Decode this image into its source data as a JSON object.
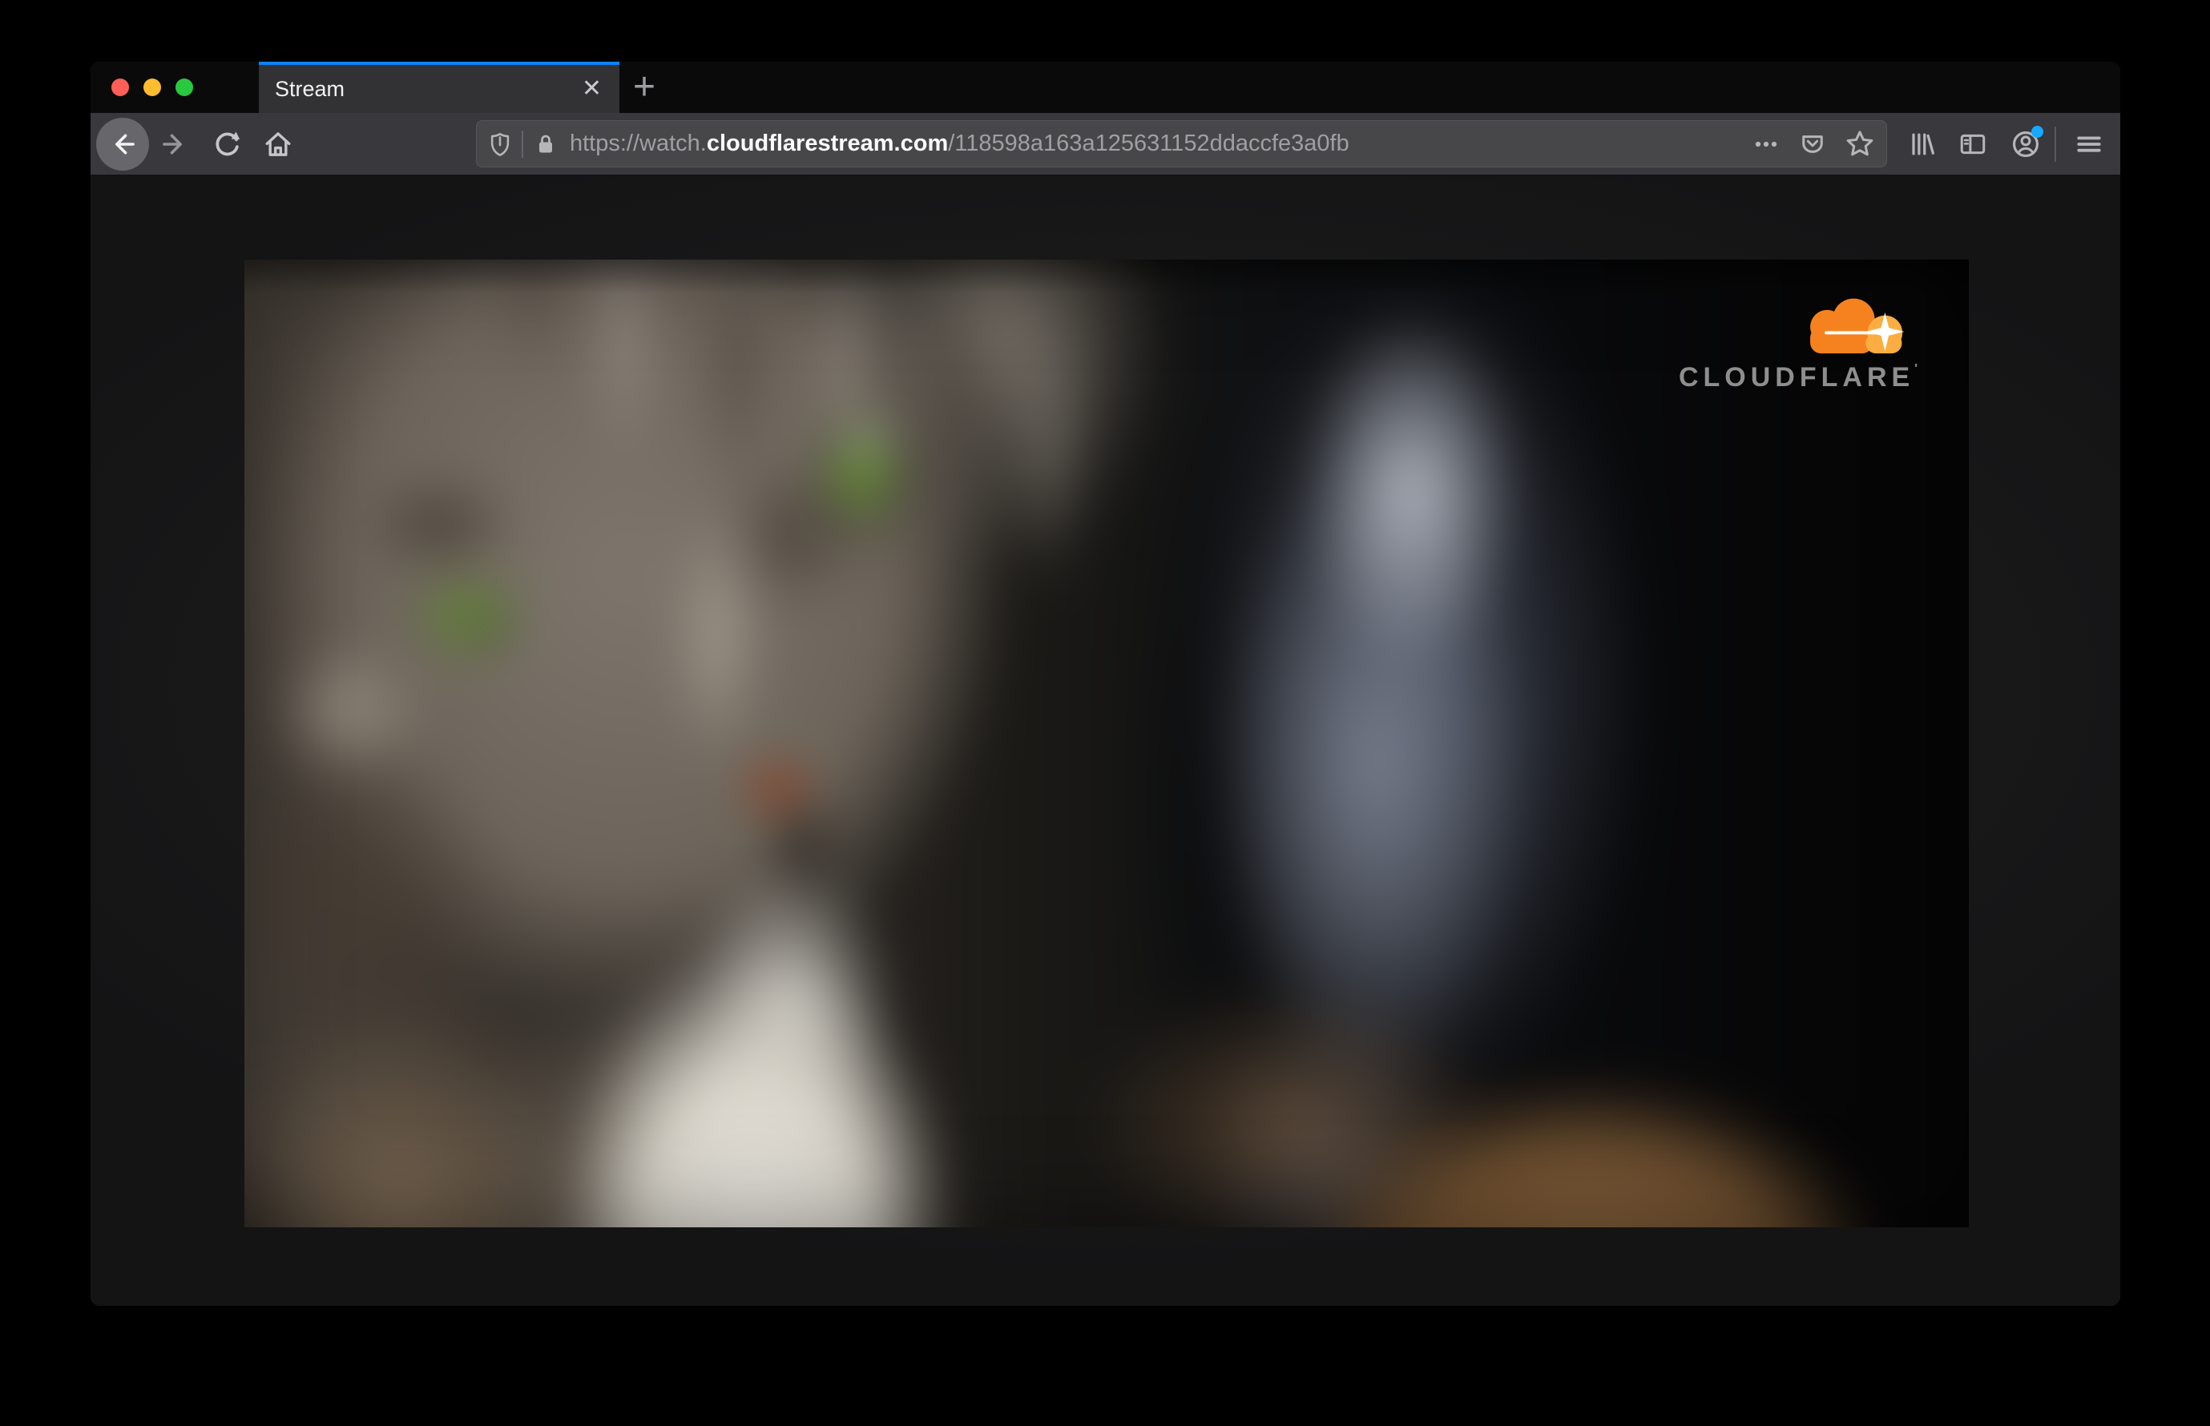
{
  "browser": {
    "window_controls": [
      {
        "name": "close",
        "color": "#ff5f57"
      },
      {
        "name": "minimize",
        "color": "#febc2e"
      },
      {
        "name": "zoom",
        "color": "#28c840"
      }
    ],
    "tab_bar": {
      "active_tab": {
        "title": "Stream",
        "close_glyph": "✕"
      },
      "new_tab_glyph": "+"
    },
    "navigation_icons": [
      "back-arrow",
      "forward-arrow",
      "reload",
      "home"
    ],
    "address_bar": {
      "security_icons": [
        "tracking-protection-shield",
        "https-lock"
      ],
      "url_prefix": "https://watch.",
      "url_host": "cloudflarestream.com",
      "url_path": "/118598a163a125631152ddaccfe3a0fb",
      "page_action_icons": [
        "ellipsis",
        "pocket",
        "bookmark-star"
      ]
    },
    "toolbar_right_icons": [
      "library",
      "sidebar",
      "account",
      "menu"
    ],
    "account_has_notification_dot": true
  },
  "page": {
    "video": {
      "watermark_brand": "CLOUDFLARE",
      "watermark_trademark": "'",
      "content": "blurred close-up of a gray tabby cat with green eyes"
    }
  },
  "colors": {
    "accent_blue": "#0a84ff",
    "notification_dot": "#17a9fd",
    "cloudflare_orange": "#f6821f",
    "cloudflare_orange_light": "#fbad41",
    "traffic_red": "#ff5f57",
    "traffic_yellow": "#febc2e",
    "traffic_green": "#28c840"
  }
}
